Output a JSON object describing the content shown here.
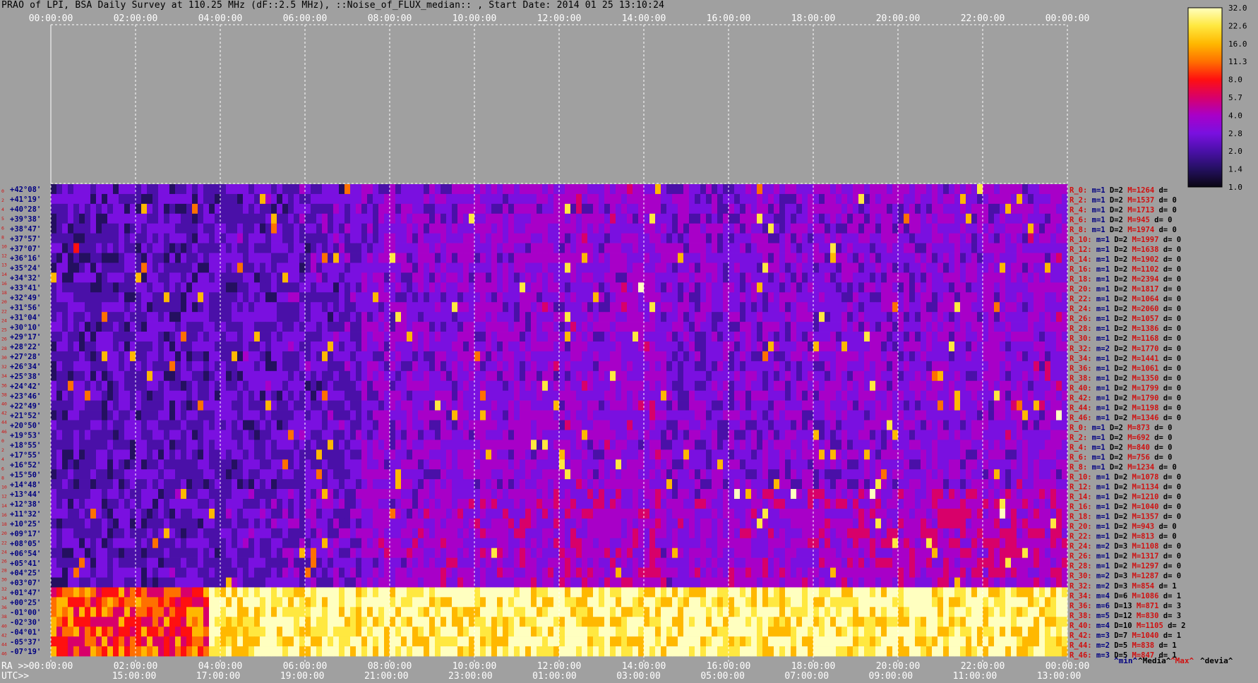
{
  "title": "PRAO of LPI, BSA Daily Survey at 110.25 MHz (dF::2.5 MHz), ::Noise_of_FLUX_median:: , Start Date: 2014 01 25 13:10:24",
  "chart_data": {
    "type": "heatmap",
    "top_time_ticks": [
      "00:00:00",
      "02:00:00",
      "04:00:00",
      "06:00:00",
      "08:00:00",
      "10:00:00",
      "12:00:00",
      "14:00:00",
      "16:00:00",
      "18:00:00",
      "20:00:00",
      "22:00:00",
      "00:00:00"
    ],
    "ra_prefix": "RA >>",
    "ra_ticks": [
      "00:00:00",
      "02:00:00",
      "04:00:00",
      "06:00:00",
      "08:00:00",
      "10:00:00",
      "12:00:00",
      "14:00:00",
      "16:00:00",
      "18:00:00",
      "20:00:00",
      "22:00:00",
      "00:00:00"
    ],
    "utc_prefix": "UTC>>",
    "utc_ticks": [
      "15:00:00",
      "17:00:00",
      "19:00:00",
      "21:00:00",
      "23:00:00",
      "01:00:00",
      "03:00:00",
      "05:00:00",
      "07:00:00",
      "09:00:00",
      "11:00:00",
      "13:00:00"
    ],
    "declinations": [
      "+42°08'",
      "+41°19'",
      "+40°28'",
      "+39°38'",
      "+38°47'",
      "+37°57'",
      "+37°07'",
      "+36°16'",
      "+35°24'",
      "+34°32'",
      "+33°41'",
      "+32°49'",
      "+31°56'",
      "+31°04'",
      "+30°10'",
      "+29°17'",
      "+28°22'",
      "+27°28'",
      "+26°34'",
      "+25°38'",
      "+24°42'",
      "+23°46'",
      "+22°49'",
      "+21°52'",
      "+20°50'",
      "+19°53'",
      "+18°55'",
      "+17°55'",
      "+16°52'",
      "+15°50'",
      "+14°48'",
      "+13°44'",
      "+12°38'",
      "+11°32'",
      "+10°25'",
      "+09°17'",
      "+08°05'",
      "+06°54'",
      "+05°41'",
      "+04°25'",
      "+03°07'",
      "+01°47'",
      "+00°25'",
      "-01°00'",
      "-02°30'",
      "-04°01'",
      "-05°37'",
      "-07°19'"
    ],
    "beam_index": [
      "0",
      "2",
      "4",
      "5",
      "6",
      "8",
      "10",
      "12",
      "13",
      "14",
      "16",
      "18",
      "20",
      "22",
      "24",
      "25",
      "26",
      "28",
      "30",
      "32",
      "34",
      "36",
      "38",
      "40",
      "42",
      "44",
      "46",
      "0",
      "2",
      "4",
      "6",
      "8",
      "10",
      "12",
      "14",
      "16",
      "18",
      "20",
      "22",
      "24",
      "26",
      "28",
      "30",
      "32",
      "34",
      "36",
      "38",
      "40",
      "42",
      "44",
      "46"
    ],
    "beam_stats": [
      {
        "r": "R_0:",
        "m": "m=1",
        "d": "D=2",
        "M": "M=1264",
        "dv": "d="
      },
      {
        "r": "R_2:",
        "m": "m=1",
        "d": "D=2",
        "M": "M=1537",
        "dv": "d= 0"
      },
      {
        "r": "R_4:",
        "m": "m=1",
        "d": "D=2",
        "M": "M=1713",
        "dv": "d= 0"
      },
      {
        "r": "R_6:",
        "m": "m=1",
        "d": "D=2",
        "M": "M=945",
        "dv": "d= 0"
      },
      {
        "r": "R_8:",
        "m": "m=1",
        "d": "D=2",
        "M": "M=1974",
        "dv": "d= 0"
      },
      {
        "r": "R_10:",
        "m": "m=1",
        "d": "D=2",
        "M": "M=1997",
        "dv": "d= 0"
      },
      {
        "r": "R_12:",
        "m": "m=1",
        "d": "D=2",
        "M": "M=1638",
        "dv": "d= 0"
      },
      {
        "r": "R_14:",
        "m": "m=1",
        "d": "D=2",
        "M": "M=1902",
        "dv": "d= 0"
      },
      {
        "r": "R_16:",
        "m": "m=1",
        "d": "D=2",
        "M": "M=1102",
        "dv": "d= 0"
      },
      {
        "r": "R_18:",
        "m": "m=1",
        "d": "D=2",
        "M": "M=2394",
        "dv": "d= 0"
      },
      {
        "r": "R_20:",
        "m": "m=1",
        "d": "D=2",
        "M": "M=1817",
        "dv": "d= 0"
      },
      {
        "r": "R_22:",
        "m": "m=1",
        "d": "D=2",
        "M": "M=1064",
        "dv": "d= 0"
      },
      {
        "r": "R_24:",
        "m": "m=1",
        "d": "D=2",
        "M": "M=2060",
        "dv": "d= 0"
      },
      {
        "r": "R_26:",
        "m": "m=1",
        "d": "D=2",
        "M": "M=1057",
        "dv": "d= 0"
      },
      {
        "r": "R_28:",
        "m": "m=1",
        "d": "D=2",
        "M": "M=1386",
        "dv": "d= 0"
      },
      {
        "r": "R_30:",
        "m": "m=1",
        "d": "D=2",
        "M": "M=1168",
        "dv": "d= 0"
      },
      {
        "r": "R_32:",
        "m": "m=2",
        "d": "D=2",
        "M": "M=1770",
        "dv": "d= 0"
      },
      {
        "r": "R_34:",
        "m": "m=1",
        "d": "D=2",
        "M": "M=1441",
        "dv": "d= 0"
      },
      {
        "r": "R_36:",
        "m": "m=1",
        "d": "D=2",
        "M": "M=1061",
        "dv": "d= 0"
      },
      {
        "r": "R_38:",
        "m": "m=1",
        "d": "D=2",
        "M": "M=1350",
        "dv": "d= 0"
      },
      {
        "r": "R_40:",
        "m": "m=1",
        "d": "D=2",
        "M": "M=1799",
        "dv": "d= 0"
      },
      {
        "r": "R_42:",
        "m": "m=1",
        "d": "D=2",
        "M": "M=1790",
        "dv": "d= 0"
      },
      {
        "r": "R_44:",
        "m": "m=1",
        "d": "D=2",
        "M": "M=1198",
        "dv": "d= 0"
      },
      {
        "r": "R_46:",
        "m": "m=1",
        "d": "D=2",
        "M": "M=1346",
        "dv": "d= 0"
      },
      {
        "r": "R_0:",
        "m": "m=1",
        "d": "D=2",
        "M": "M=873",
        "dv": "d= 0"
      },
      {
        "r": "R_2:",
        "m": "m=1",
        "d": "D=2",
        "M": "M=692",
        "dv": "d= 0"
      },
      {
        "r": "R_4:",
        "m": "m=1",
        "d": "D=2",
        "M": "M=840",
        "dv": "d= 0"
      },
      {
        "r": "R_6:",
        "m": "m=1",
        "d": "D=2",
        "M": "M=756",
        "dv": "d= 0"
      },
      {
        "r": "R_8:",
        "m": "m=1",
        "d": "D=2",
        "M": "M=1234",
        "dv": "d= 0"
      },
      {
        "r": "R_10:",
        "m": "m=1",
        "d": "D=2",
        "M": "M=1078",
        "dv": "d= 0"
      },
      {
        "r": "R_12:",
        "m": "m=1",
        "d": "D=2",
        "M": "M=1134",
        "dv": "d= 0"
      },
      {
        "r": "R_14:",
        "m": "m=1",
        "d": "D=2",
        "M": "M=1210",
        "dv": "d= 0"
      },
      {
        "r": "R_16:",
        "m": "m=1",
        "d": "D=2",
        "M": "M=1040",
        "dv": "d= 0"
      },
      {
        "r": "R_18:",
        "m": "m=1",
        "d": "D=2",
        "M": "M=1357",
        "dv": "d= 0"
      },
      {
        "r": "R_20:",
        "m": "m=1",
        "d": "D=2",
        "M": "M=943",
        "dv": "d= 0"
      },
      {
        "r": "R_22:",
        "m": "m=1",
        "d": "D=2",
        "M": "M=813",
        "dv": "d= 0"
      },
      {
        "r": "R_24:",
        "m": "m=2",
        "d": "D=3",
        "M": "M=1108",
        "dv": "d= 0"
      },
      {
        "r": "R_26:",
        "m": "m=1",
        "d": "D=2",
        "M": "M=1317",
        "dv": "d= 0"
      },
      {
        "r": "R_28:",
        "m": "m=1",
        "d": "D=2",
        "M": "M=1297",
        "dv": "d= 0"
      },
      {
        "r": "R_30:",
        "m": "m=2",
        "d": "D=3",
        "M": "M=1287",
        "dv": "d= 0"
      },
      {
        "r": "R_32:",
        "m": "m=2",
        "d": "D=3",
        "M": "M=854",
        "dv": "d= 1"
      },
      {
        "r": "R_34:",
        "m": "m=4",
        "d": "D=6",
        "M": "M=1086",
        "dv": "d= 1"
      },
      {
        "r": "R_36:",
        "m": "m=6",
        "d": "D=13",
        "M": "M=871",
        "dv": "d= 3"
      },
      {
        "r": "R_38:",
        "m": "m=5",
        "d": "D=12",
        "M": "M=830",
        "dv": "d= 3"
      },
      {
        "r": "R_40:",
        "m": "m=4",
        "d": "D=10",
        "M": "M=1105",
        "dv": "d= 2"
      },
      {
        "r": "R_42:",
        "m": "m=3",
        "d": "D=7",
        "M": "M=1040",
        "dv": "d= 1"
      },
      {
        "r": "R_44:",
        "m": "m=2",
        "d": "D=5",
        "M": "M=838",
        "dv": "d= 1"
      },
      {
        "r": "R_46:",
        "m": "m=3",
        "d": "D=5",
        "M": "M=847",
        "dv": "d= 1"
      }
    ],
    "legend_keys": [
      "^min^",
      "^Media^",
      "^Max^",
      "^devia^"
    ],
    "colorbar_ticks": [
      "32.0",
      "22.6",
      "16.0",
      "11.3",
      "8.0",
      "5.7",
      "4.0",
      "2.8",
      "2.0",
      "1.4",
      "1.0"
    ],
    "colorbar_range": [
      1.0,
      32.0
    ],
    "colormap": [
      "#0a0612",
      "#241060",
      "#4a10a8",
      "#7a10e0",
      "#a800c8",
      "#d8006a",
      "#ff1010",
      "#ff7000",
      "#ffb800",
      "#ffe840",
      "#ffffc0"
    ],
    "colors": {
      "background": "#a0a0a0",
      "grid": "#ffffff",
      "dec_text": "#000080",
      "index_text": "#d01010",
      "stat_m": "#000080",
      "stat_M": "#d01010",
      "stat_r": "#d01010"
    }
  }
}
